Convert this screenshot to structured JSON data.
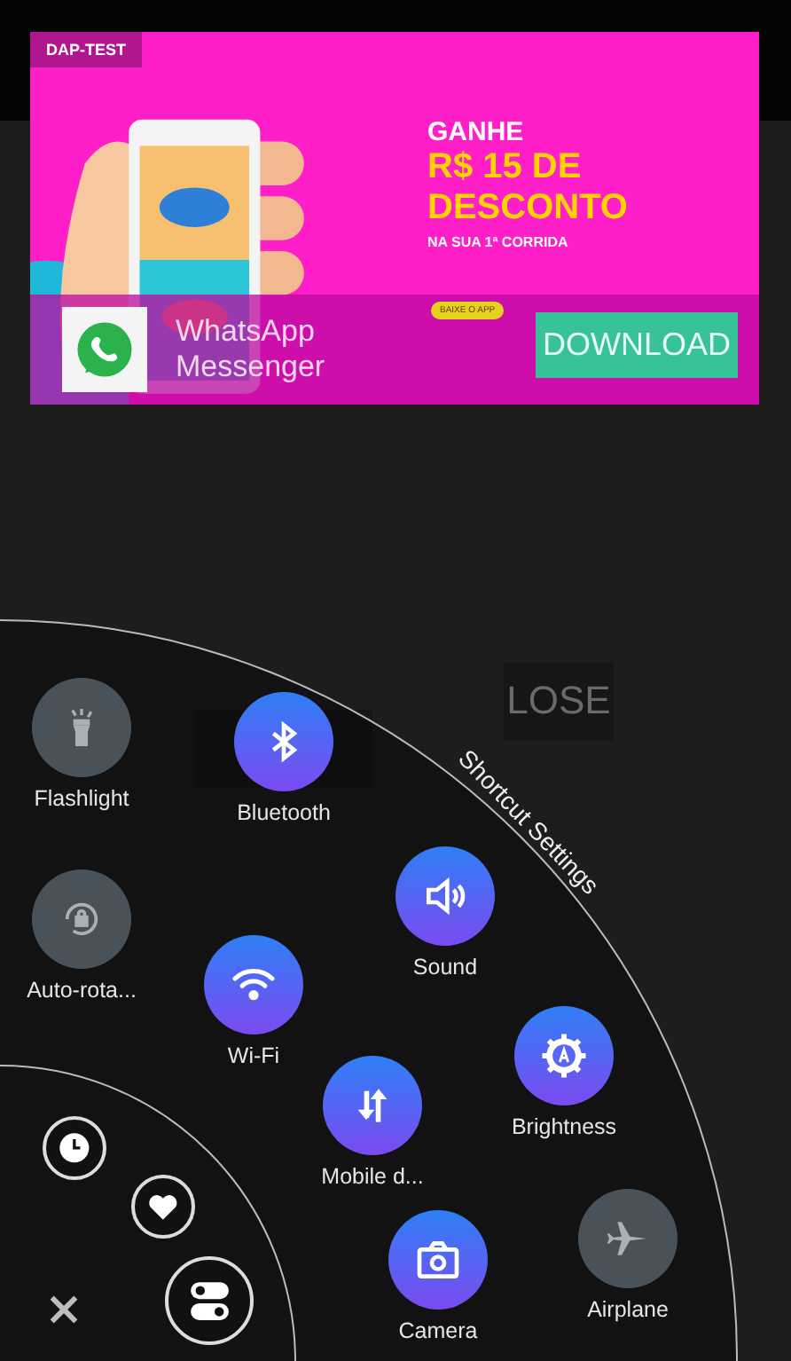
{
  "ad": {
    "tag": "DAP-TEST",
    "headline": "GANHE",
    "amount": "R$ 15 DE",
    "discount": "DESCONTO",
    "subline": "NA SUA 1ª CORRIDA",
    "pill": "BAIXE O APP",
    "app_name": "WhatsApp",
    "app_subtitle": "Messenger",
    "download": "DOWNLOAD"
  },
  "background_buttons": [
    {
      "kind": "blank"
    },
    {
      "kind": "text",
      "label": "LOSE"
    }
  ],
  "menu": {
    "title": "Shortcut Settings",
    "shortcuts": [
      {
        "kind": "flashlight",
        "label": "Flashlight",
        "on": false
      },
      {
        "kind": "autorotate",
        "label": "Auto-rota...",
        "on": false
      },
      {
        "kind": "bluetooth",
        "label": "Bluetooth",
        "on": true
      },
      {
        "kind": "wifi",
        "label": "Wi-Fi",
        "on": true
      },
      {
        "kind": "sound",
        "label": "Sound",
        "on": true
      },
      {
        "kind": "mobiledata",
        "label": "Mobile d...",
        "on": true
      },
      {
        "kind": "brightness",
        "label": "Brightness",
        "on": true
      },
      {
        "kind": "camera",
        "label": "Camera",
        "on": true
      },
      {
        "kind": "airplane",
        "label": "Airplane",
        "on": false
      }
    ],
    "quick_actions": [
      {
        "kind": "clock"
      },
      {
        "kind": "heart"
      },
      {
        "kind": "toggles"
      },
      {
        "kind": "close"
      }
    ]
  }
}
